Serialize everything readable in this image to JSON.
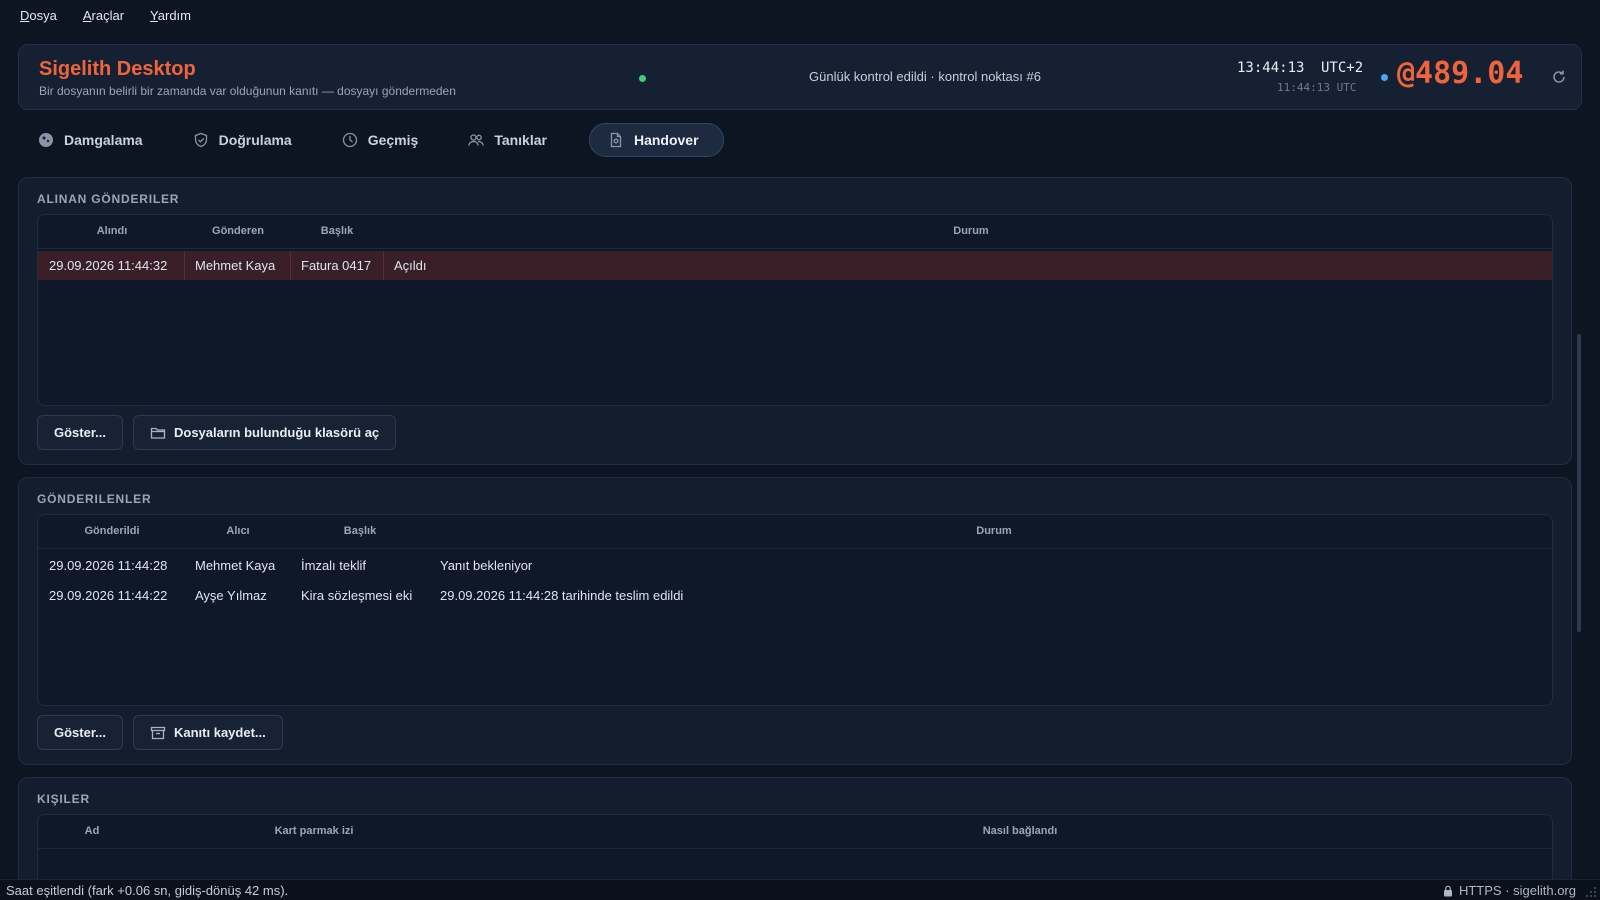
{
  "menu": {
    "items": [
      "Dosya",
      "Araçlar",
      "Yardım"
    ]
  },
  "header": {
    "title": "Sigelith Desktop",
    "subtitle": "Bir dosyanın belirli bir zamanda var olduğunun kanıtı — dosyayı göndermeden",
    "status_text": "Günlük kontrol edildi · kontrol noktası #6",
    "local_time": "13:44:13",
    "timezone": "UTC+2",
    "utc_time": "11:44:13 UTC",
    "counter": "@489.04",
    "accent_color": "#f0643c"
  },
  "tabs": [
    {
      "label": "Damgalama",
      "icon": "stamp-icon"
    },
    {
      "label": "Doğrulama",
      "icon": "shield-icon"
    },
    {
      "label": "Geçmiş",
      "icon": "clock-icon"
    },
    {
      "label": "Tanıklar",
      "icon": "users-icon"
    },
    {
      "label": "Handover",
      "icon": "document-icon",
      "active": true
    }
  ],
  "received": {
    "title": "ALINAN GÖNDERILER",
    "columns": [
      "Alındı",
      "Gönderen",
      "Başlık",
      "Durum"
    ],
    "rows": [
      {
        "date": "29.09.2026 11:44:32",
        "sender": "Mehmet Kaya",
        "title": "Fatura 0417",
        "status": "Açıldı"
      }
    ],
    "show_button": "Göster...",
    "folder_button": "Dosyaların bulunduğu klasörü aç"
  },
  "sent": {
    "title": "GÖNDERILENLER",
    "columns": [
      "Gönderildi",
      "Alıcı",
      "Başlık",
      "Durum"
    ],
    "rows": [
      {
        "date": "29.09.2026 11:44:28",
        "recipient": "Mehmet Kaya",
        "title": "İmzalı teklif",
        "status": "Yanıt bekleniyor"
      },
      {
        "date": "29.09.2026 11:44:22",
        "recipient": "Ayşe Yılmaz",
        "title": "Kira sözleşmesi eki",
        "status": "29.09.2026 11:44:28 tarihinde teslim edildi"
      }
    ],
    "show_button": "Göster...",
    "save_button": "Kanıtı kaydet..."
  },
  "contacts": {
    "title": "KIŞILER",
    "columns": [
      "Ad",
      "Kart parmak izi",
      "Nasıl bağlandı"
    ]
  },
  "statusbar": {
    "left": "Saat eşitlendi (fark +0.06 sn, gidiş-dönüş 42 ms).",
    "right": "HTTPS · sigelith.org"
  }
}
